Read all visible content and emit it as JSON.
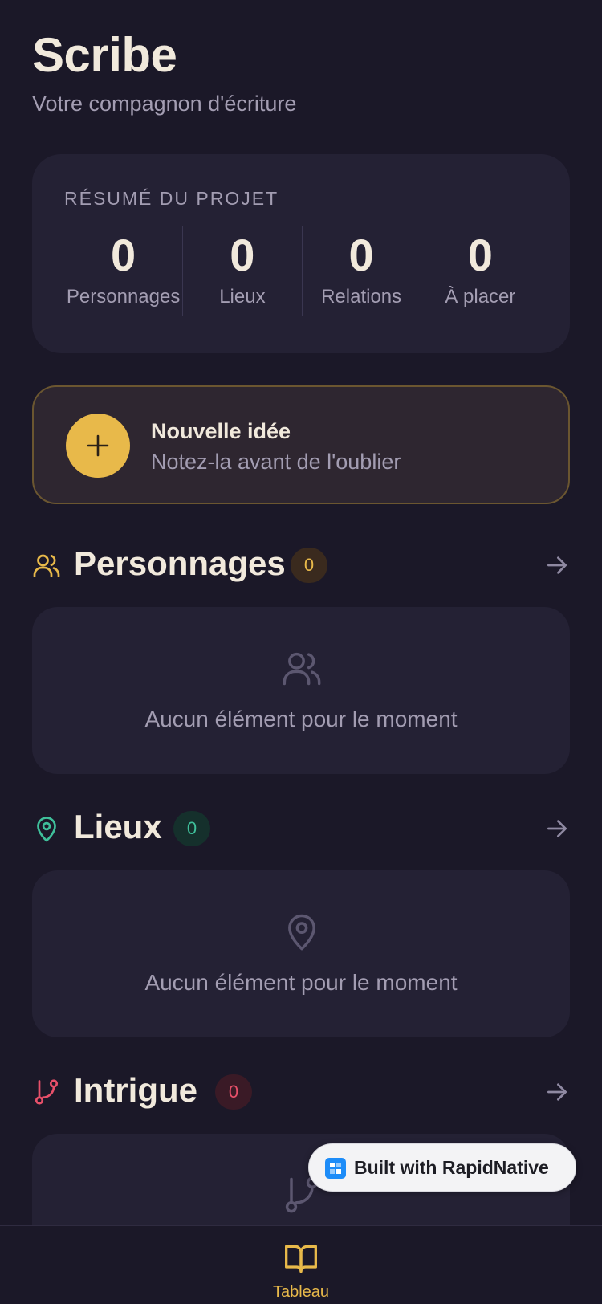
{
  "header": {
    "title": "Scribe",
    "subtitle": "Votre compagnon d'écriture"
  },
  "summary": {
    "label": "RÉSUMÉ DU PROJET",
    "stats": [
      {
        "value": "0",
        "label": "Personnages"
      },
      {
        "value": "0",
        "label": "Lieux"
      },
      {
        "value": "0",
        "label": "Relations"
      },
      {
        "value": "0",
        "label": "À placer"
      }
    ]
  },
  "idea": {
    "title": "Nouvelle idée",
    "subtitle": "Notez-la avant de l'oublier"
  },
  "sections": [
    {
      "title": "Personnages",
      "count": "0",
      "empty_text": "Aucun élément pour le moment",
      "icon": "users-icon",
      "color": "#e8b94a"
    },
    {
      "title": "Lieux",
      "count": "0",
      "empty_text": "Aucun élément pour le moment",
      "icon": "map-pin-icon",
      "color": "#3fbf9a"
    },
    {
      "title": "Intrigue",
      "count": "0",
      "empty_text": "",
      "icon": "git-branch-icon",
      "color": "#e8506a"
    }
  ],
  "bottom_nav": {
    "active_tab": "Tableau",
    "icon": "book-open-icon"
  },
  "badge": {
    "text": "Built with RapidNative"
  },
  "colors": {
    "background": "#1b1828",
    "card": "#242134",
    "accent": "#e8b94a"
  }
}
